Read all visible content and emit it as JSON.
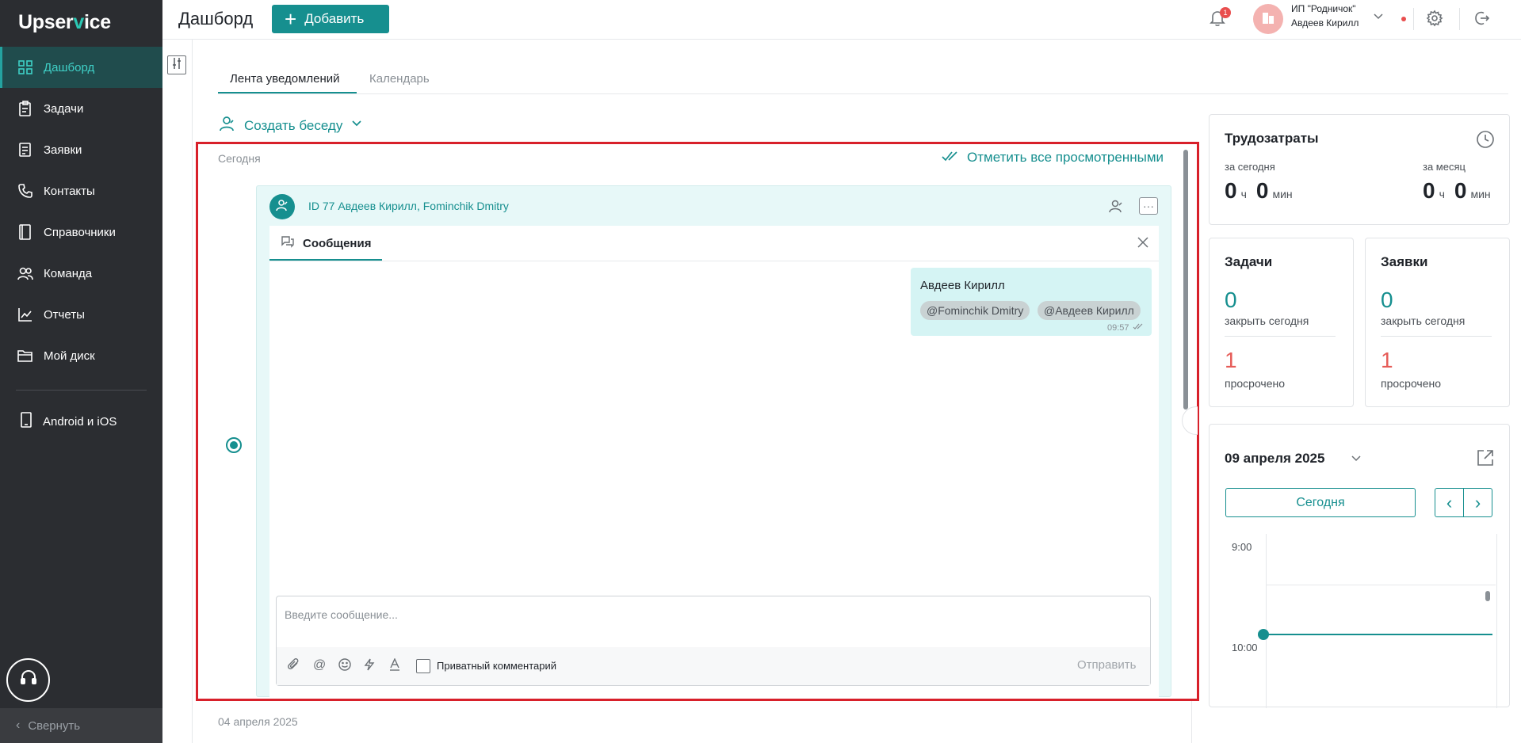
{
  "sidebar": {
    "logo_prefix": "Upser",
    "logo_v": "v",
    "logo_suffix": "ice",
    "items": [
      {
        "label": "Дашборд",
        "icon": "dashboard-icon"
      },
      {
        "label": "Задачи",
        "icon": "tasks-icon"
      },
      {
        "label": "Заявки",
        "icon": "requests-icon"
      },
      {
        "label": "Контакты",
        "icon": "phone-icon"
      },
      {
        "label": "Справочники",
        "icon": "book-icon"
      },
      {
        "label": "Команда",
        "icon": "team-icon"
      },
      {
        "label": "Отчеты",
        "icon": "chart-icon"
      },
      {
        "label": "Мой диск",
        "icon": "folder-icon"
      }
    ],
    "mobile_label": "Android и iOS",
    "collapse_label": "Свернуть"
  },
  "header": {
    "title": "Дашборд",
    "add_label": "Добавить",
    "notifications_count": "1",
    "org_name": "ИП \"Родничок\"",
    "user_name": "Авдеев Кирилл"
  },
  "tabs": {
    "feed": "Лента уведомлений",
    "calendar": "Календарь"
  },
  "feed": {
    "create_chat": "Создать беседу",
    "today_label": "Сегодня",
    "mark_all": "Отметить все просмотренными",
    "card_title": "ID 77 Авдеев Кирилл, Fominchik Dmitry",
    "messages_tab": "Сообщения",
    "message": {
      "author": "Авдеев Кирилл",
      "mentions": [
        "@Fominchik Dmitry",
        "@Авдеев Кирилл"
      ],
      "time": "09:57"
    },
    "composer_placeholder": "Введите сообщение...",
    "private_label": "Приватный комментарий",
    "send_label": "Отправить",
    "older_date": "04 апреля 2025"
  },
  "labor": {
    "title": "Трудозатраты",
    "today_label": "за сегодня",
    "month_label": "за месяц",
    "today_hours": "0",
    "today_mins": "0",
    "month_hours": "0",
    "month_mins": "0",
    "hours_unit": "ч",
    "mins_unit": "мин"
  },
  "tasks": {
    "title": "Задачи",
    "close_today": "0",
    "close_today_label": "закрыть сегодня",
    "overdue": "1",
    "overdue_label": "просрочено"
  },
  "requests": {
    "title": "Заявки",
    "close_today": "0",
    "close_today_label": "закрыть сегодня",
    "overdue": "1",
    "overdue_label": "просрочено"
  },
  "calendar": {
    "date": "09 апреля 2025",
    "today_btn": "Сегодня",
    "hours": [
      "9:00",
      "10:00"
    ]
  },
  "colors": {
    "accent": "#168f8f",
    "sidebar": "#2b2d31",
    "danger": "#e65c58",
    "highlight": "#d8202a"
  }
}
